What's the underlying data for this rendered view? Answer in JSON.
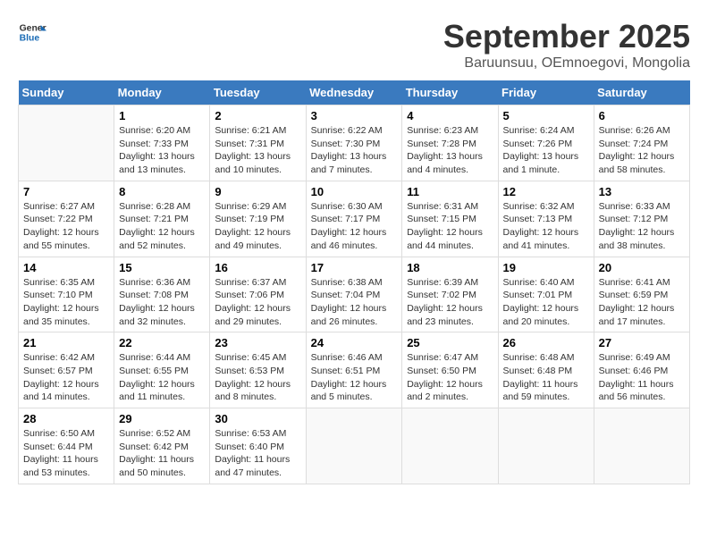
{
  "header": {
    "logo_line1": "General",
    "logo_line2": "Blue",
    "month_title": "September 2025",
    "subtitle": "Baruunsuu, OEmnoegovi, Mongolia"
  },
  "weekdays": [
    "Sunday",
    "Monday",
    "Tuesday",
    "Wednesday",
    "Thursday",
    "Friday",
    "Saturday"
  ],
  "weeks": [
    [
      {
        "day": "",
        "info": ""
      },
      {
        "day": "1",
        "info": "Sunrise: 6:20 AM\nSunset: 7:33 PM\nDaylight: 13 hours\nand 13 minutes."
      },
      {
        "day": "2",
        "info": "Sunrise: 6:21 AM\nSunset: 7:31 PM\nDaylight: 13 hours\nand 10 minutes."
      },
      {
        "day": "3",
        "info": "Sunrise: 6:22 AM\nSunset: 7:30 PM\nDaylight: 13 hours\nand 7 minutes."
      },
      {
        "day": "4",
        "info": "Sunrise: 6:23 AM\nSunset: 7:28 PM\nDaylight: 13 hours\nand 4 minutes."
      },
      {
        "day": "5",
        "info": "Sunrise: 6:24 AM\nSunset: 7:26 PM\nDaylight: 13 hours\nand 1 minute."
      },
      {
        "day": "6",
        "info": "Sunrise: 6:26 AM\nSunset: 7:24 PM\nDaylight: 12 hours\nand 58 minutes."
      }
    ],
    [
      {
        "day": "7",
        "info": "Sunrise: 6:27 AM\nSunset: 7:22 PM\nDaylight: 12 hours\nand 55 minutes."
      },
      {
        "day": "8",
        "info": "Sunrise: 6:28 AM\nSunset: 7:21 PM\nDaylight: 12 hours\nand 52 minutes."
      },
      {
        "day": "9",
        "info": "Sunrise: 6:29 AM\nSunset: 7:19 PM\nDaylight: 12 hours\nand 49 minutes."
      },
      {
        "day": "10",
        "info": "Sunrise: 6:30 AM\nSunset: 7:17 PM\nDaylight: 12 hours\nand 46 minutes."
      },
      {
        "day": "11",
        "info": "Sunrise: 6:31 AM\nSunset: 7:15 PM\nDaylight: 12 hours\nand 44 minutes."
      },
      {
        "day": "12",
        "info": "Sunrise: 6:32 AM\nSunset: 7:13 PM\nDaylight: 12 hours\nand 41 minutes."
      },
      {
        "day": "13",
        "info": "Sunrise: 6:33 AM\nSunset: 7:12 PM\nDaylight: 12 hours\nand 38 minutes."
      }
    ],
    [
      {
        "day": "14",
        "info": "Sunrise: 6:35 AM\nSunset: 7:10 PM\nDaylight: 12 hours\nand 35 minutes."
      },
      {
        "day": "15",
        "info": "Sunrise: 6:36 AM\nSunset: 7:08 PM\nDaylight: 12 hours\nand 32 minutes."
      },
      {
        "day": "16",
        "info": "Sunrise: 6:37 AM\nSunset: 7:06 PM\nDaylight: 12 hours\nand 29 minutes."
      },
      {
        "day": "17",
        "info": "Sunrise: 6:38 AM\nSunset: 7:04 PM\nDaylight: 12 hours\nand 26 minutes."
      },
      {
        "day": "18",
        "info": "Sunrise: 6:39 AM\nSunset: 7:02 PM\nDaylight: 12 hours\nand 23 minutes."
      },
      {
        "day": "19",
        "info": "Sunrise: 6:40 AM\nSunset: 7:01 PM\nDaylight: 12 hours\nand 20 minutes."
      },
      {
        "day": "20",
        "info": "Sunrise: 6:41 AM\nSunset: 6:59 PM\nDaylight: 12 hours\nand 17 minutes."
      }
    ],
    [
      {
        "day": "21",
        "info": "Sunrise: 6:42 AM\nSunset: 6:57 PM\nDaylight: 12 hours\nand 14 minutes."
      },
      {
        "day": "22",
        "info": "Sunrise: 6:44 AM\nSunset: 6:55 PM\nDaylight: 12 hours\nand 11 minutes."
      },
      {
        "day": "23",
        "info": "Sunrise: 6:45 AM\nSunset: 6:53 PM\nDaylight: 12 hours\nand 8 minutes."
      },
      {
        "day": "24",
        "info": "Sunrise: 6:46 AM\nSunset: 6:51 PM\nDaylight: 12 hours\nand 5 minutes."
      },
      {
        "day": "25",
        "info": "Sunrise: 6:47 AM\nSunset: 6:50 PM\nDaylight: 12 hours\nand 2 minutes."
      },
      {
        "day": "26",
        "info": "Sunrise: 6:48 AM\nSunset: 6:48 PM\nDaylight: 11 hours\nand 59 minutes."
      },
      {
        "day": "27",
        "info": "Sunrise: 6:49 AM\nSunset: 6:46 PM\nDaylight: 11 hours\nand 56 minutes."
      }
    ],
    [
      {
        "day": "28",
        "info": "Sunrise: 6:50 AM\nSunset: 6:44 PM\nDaylight: 11 hours\nand 53 minutes."
      },
      {
        "day": "29",
        "info": "Sunrise: 6:52 AM\nSunset: 6:42 PM\nDaylight: 11 hours\nand 50 minutes."
      },
      {
        "day": "30",
        "info": "Sunrise: 6:53 AM\nSunset: 6:40 PM\nDaylight: 11 hours\nand 47 minutes."
      },
      {
        "day": "",
        "info": ""
      },
      {
        "day": "",
        "info": ""
      },
      {
        "day": "",
        "info": ""
      },
      {
        "day": "",
        "info": ""
      }
    ]
  ]
}
